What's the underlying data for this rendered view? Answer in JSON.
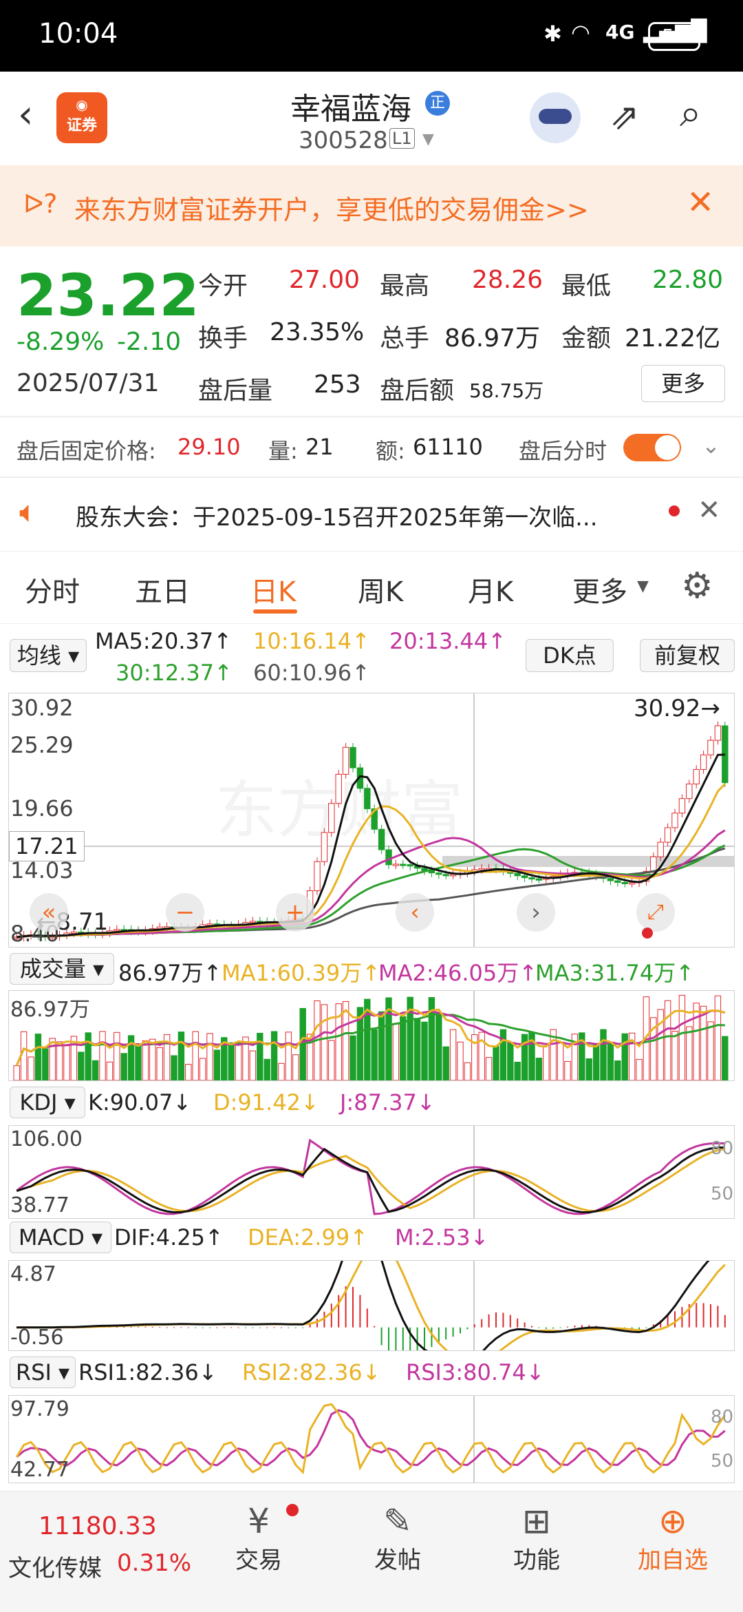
{
  "status": {
    "time": "10:04",
    "network": "4G",
    "battery": "55"
  },
  "header": {
    "title": "幸福蓝海",
    "code": "300528",
    "level": "L1",
    "broker_badge": "证券"
  },
  "banner": {
    "text": "来东方财富证券开户，享更低的交易佣金>>"
  },
  "quote": {
    "price": "23.22",
    "change_pct": "-8.29%",
    "change": "-2.10",
    "date": "2025/07/31",
    "open_label": "今开",
    "open": "27.00",
    "high_label": "最高",
    "high": "28.26",
    "low_label": "最低",
    "low": "22.80",
    "turnover_label": "换手",
    "turnover": "23.35%",
    "volume_label": "总手",
    "volume": "86.97万",
    "amount_label": "金额",
    "amount": "21.22亿",
    "after_vol_label": "盘后量",
    "after_vol": "253",
    "after_amt_label": "盘后额",
    "after_amt": "58.75万",
    "more_button": "更多"
  },
  "afterhours": {
    "price_label": "盘后固定价格:",
    "price": "29.10",
    "qty_label": "量:",
    "qty": "21",
    "amt_label": "额:",
    "amt": "61110",
    "toggle_label": "盘后分时"
  },
  "notice": {
    "text": "股东大会：于2025-09-15召开2025年第一次临..."
  },
  "tabs": [
    "分时",
    "五日",
    "日K",
    "周K",
    "月K",
    "更多"
  ],
  "active_tab": "日K",
  "ma": {
    "selector": "均线",
    "ma5": "MA5:20.37↑",
    "ma10": "10:16.14↑",
    "ma20": "20:13.44↑",
    "ma30": "30:12.37↑",
    "ma60": "60:10.96↑",
    "dk_button": "DK点",
    "adjust_button": "前复权"
  },
  "kchart": {
    "y_top": "30.92",
    "y2": "25.29",
    "y3": "19.66",
    "crosshair": "17.21",
    "y4": "14.03",
    "y_bottom": "8.40",
    "low_mark": "8.71",
    "high_mark": "30.92"
  },
  "volume": {
    "selector": "成交量",
    "v": "86.97万↑",
    "ma1": "MA1:60.39万↑",
    "ma2": "MA2:46.05万↑",
    "ma3": "MA3:31.74万↑",
    "y_top": "86.97万"
  },
  "kdj": {
    "selector": "KDJ",
    "k": "K:90.07↓",
    "d": "D:91.42↓",
    "j": "J:87.37↓",
    "y_top": "106.00",
    "y_bottom": "38.77",
    "r80": "80",
    "r50": "50"
  },
  "macd": {
    "selector": "MACD",
    "dif": "DIF:4.25↑",
    "dea": "DEA:2.99↑",
    "m": "M:2.53↓",
    "y_top": "4.87",
    "y_bottom": "-0.56"
  },
  "rsi": {
    "selector": "RSI",
    "rsi1": "RSI1:82.36↓",
    "rsi2": "RSI2:82.36↓",
    "rsi3": "RSI3:80.74↓",
    "y_top": "97.79",
    "y_bottom": "42.77",
    "r80": "80",
    "r50": "50"
  },
  "bottom": {
    "index_value": "11180.33",
    "index_name": "文化传媒",
    "index_pct": "0.31%",
    "trade": "交易",
    "post": "发帖",
    "features": "功能",
    "add_watch": "加自选"
  },
  "colors": {
    "up": "#e0262b",
    "down": "#1aa02b",
    "accent": "#f36d24",
    "ma10": "#e9b224",
    "ma20": "#c3359e",
    "ma30": "#2ca02c",
    "ma60": "#555555"
  }
}
